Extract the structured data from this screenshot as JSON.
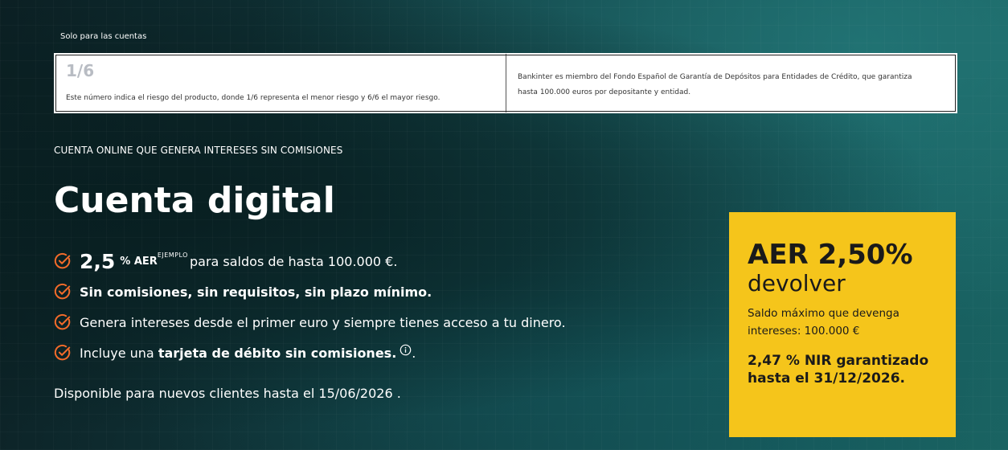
{
  "header": {
    "solo_label": "Solo para las cuentas"
  },
  "risk_box": {
    "number": "1/6",
    "description": "Este número indica el riesgo del producto, donde 1/6 representa el menor riesgo y 6/6 el mayor riesgo.",
    "guarantee_line1": "Bankinter es miembro del Fondo Español de Garantía de Depósitos para Entidades de Crédito, que garantiza",
    "guarantee_line2": "hasta 100.000 euros por depositante y entidad."
  },
  "hero": {
    "eyebrow": "CUENTA ONLINE QUE GENERA INTERESES SIN COMISIONES",
    "title": "Cuenta digital"
  },
  "benefits": {
    "item1": {
      "value": "2,5",
      "unit": "% AER",
      "sup": "EJEMPLO",
      "text": "para saldos de hasta 100.000 €."
    },
    "item2": {
      "text": "Sin comisiones, sin requisitos, sin plazo mínimo."
    },
    "item3": {
      "text": "Genera intereses desde el primer euro y siempre tienes acceso a tu dinero."
    },
    "item4": {
      "prefix": "Incluye una ",
      "bold": "tarjeta de débito sin comisiones.",
      "suffix": "."
    }
  },
  "availability": "Disponible para nuevos clientes hasta el 15/06/2026 .",
  "promo": {
    "rate": "AER 2,50%",
    "subtitle": "devolver",
    "note": "Saldo máximo que devenga intereses: 100.000 €",
    "nir_line1": "2,47 % NIR garantizado",
    "nir_line2": "hasta el 31/12/2026."
  },
  "colors": {
    "accent_orange": "#f26b2a",
    "promo_yellow": "#f5c51b"
  },
  "icons": [
    "check-circle-icon",
    "info-icon"
  ]
}
